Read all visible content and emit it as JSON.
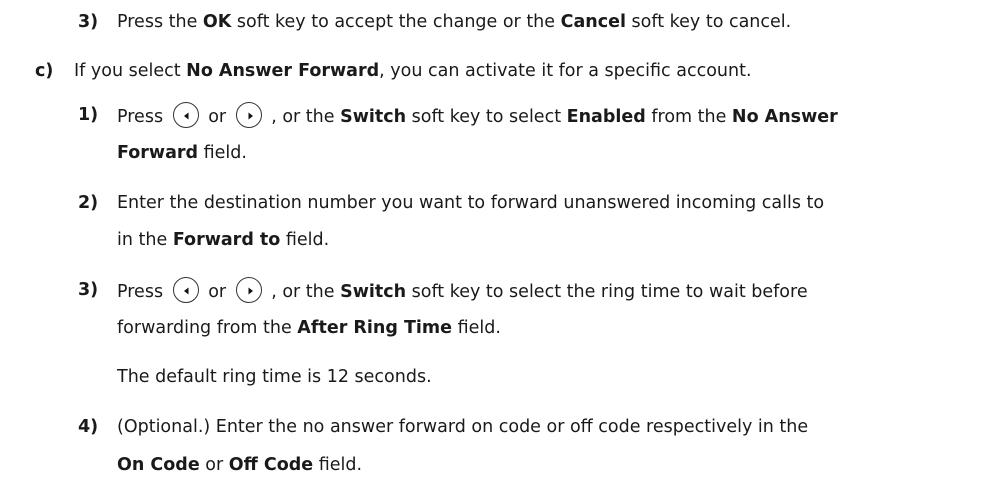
{
  "items": {
    "b3": {
      "marker": "3)",
      "l1": {
        "a": "Press the ",
        "b1": "OK",
        "c": " soft key to accept the change or the ",
        "b2": "Cancel",
        "d": " soft key to cancel."
      }
    },
    "c": {
      "marker": "c)",
      "l1": {
        "a": "If you select ",
        "b1": "No Answer Forward",
        "c": ", you can activate it for a specific account."
      }
    },
    "c1": {
      "marker": "1)",
      "l1": {
        "a": "Press ",
        "or": " or ",
        "c": " , or the ",
        "b1": "Switch",
        "d": " soft key to select ",
        "b2": "Enabled",
        "e": " from the ",
        "b3": "No Answer"
      },
      "l2": {
        "b1": "Forward",
        "a": " field."
      }
    },
    "c2": {
      "marker": "2)",
      "l1": "Enter the destination number you want to forward unanswered incoming calls to",
      "l2": {
        "a": "in the ",
        "b1": "Forward to",
        "c": " field."
      }
    },
    "c3": {
      "marker": "3)",
      "l1": {
        "a": "Press ",
        "or": " or ",
        "c": " , or the ",
        "b1": "Switch",
        "d": " soft key to select the ring time to wait before"
      },
      "l2": {
        "a": "forwarding from the ",
        "b1": "After Ring Time",
        "c": " field."
      },
      "note": "The default ring time is 12 seconds."
    },
    "c4": {
      "marker": "4)",
      "l1": "(Optional.) Enter the no answer forward on code or off code respectively in the",
      "l2": {
        "b1": "On Code",
        "a": " or ",
        "b2": "Off Code",
        "c": " field."
      }
    }
  },
  "icons": {
    "left": "left-arrow-key-icon",
    "right": "right-arrow-key-icon"
  }
}
